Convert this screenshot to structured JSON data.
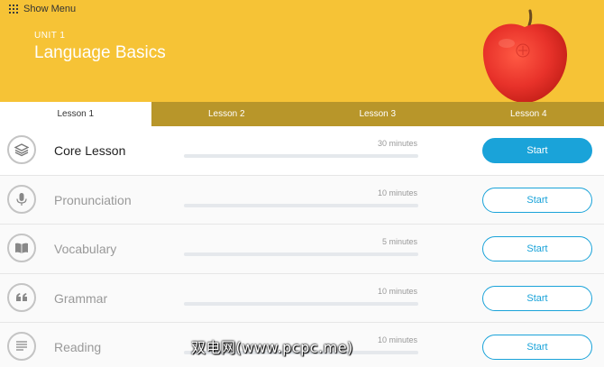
{
  "header": {
    "menu_label": "Show Menu",
    "unit_label": "UNIT 1",
    "unit_title": "Language Basics",
    "background_color": "#f6c336"
  },
  "tabs": [
    {
      "label": "Lesson 1",
      "active": true
    },
    {
      "label": "Lesson 2",
      "active": false
    },
    {
      "label": "Lesson 3",
      "active": false
    },
    {
      "label": "Lesson 4",
      "active": false
    }
  ],
  "lessons": [
    {
      "title": "Core Lesson",
      "duration": "30 minutes",
      "progress": 0,
      "icon": "layers-icon",
      "button_label": "Start",
      "current": true
    },
    {
      "title": "Pronunciation",
      "duration": "10 minutes",
      "progress": 0,
      "icon": "microphone-icon",
      "button_label": "Start",
      "current": false
    },
    {
      "title": "Vocabulary",
      "duration": "5 minutes",
      "progress": 0,
      "icon": "book-icon",
      "button_label": "Start",
      "current": false
    },
    {
      "title": "Grammar",
      "duration": "10 minutes",
      "progress": 0,
      "icon": "quote-icon",
      "button_label": "Start",
      "current": false
    },
    {
      "title": "Reading",
      "duration": "10 minutes",
      "progress": 0,
      "icon": "document-lines-icon",
      "button_label": "Start",
      "current": false
    }
  ],
  "watermark": "双电网(www.pcpc.me)",
  "colors": {
    "accent": "#1aa3d9",
    "tab_bar": "#b8962a",
    "apple": "#e8322a"
  }
}
